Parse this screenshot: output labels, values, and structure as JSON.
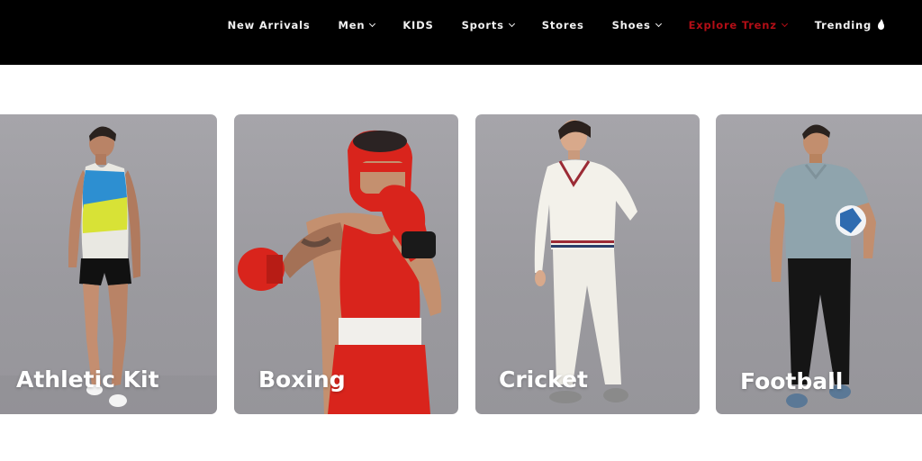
{
  "nav": {
    "items": [
      {
        "label": "New Arrivals",
        "dropdown": false
      },
      {
        "label": "Men",
        "dropdown": true
      },
      {
        "label": "KIDS",
        "dropdown": false
      },
      {
        "label": "Sports",
        "dropdown": true
      },
      {
        "label": "Stores",
        "dropdown": false
      },
      {
        "label": "Shoes",
        "dropdown": true
      },
      {
        "label": "Explore Trenz",
        "dropdown": true
      },
      {
        "label": "Trending",
        "dropdown": false
      }
    ],
    "accent_color": "#b30e16",
    "trending_icon": "flame-icon"
  },
  "categories": [
    {
      "label": "Athletic Kit"
    },
    {
      "label": "Boxing"
    },
    {
      "label": "Cricket"
    },
    {
      "label": "Football"
    }
  ]
}
